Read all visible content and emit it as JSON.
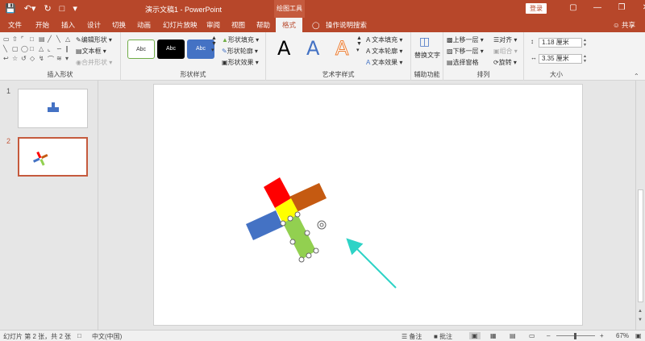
{
  "titlebar": {
    "doc_title": "演示文稿1  -  PowerPoint",
    "context_title": "绘图工具",
    "login": "登录"
  },
  "tabs": {
    "file": "文件",
    "home": "开始",
    "insert": "插入",
    "design": "设计",
    "transitions": "切换",
    "animations": "动画",
    "slideshow": "幻灯片放映",
    "review": "审阅",
    "view": "视图",
    "help": "帮助",
    "format": "格式",
    "tellme": "操作说明搜索",
    "share": "共享"
  },
  "ribbon": {
    "insert_shapes": {
      "label": "插入形状",
      "edit_shape": "编辑形状",
      "textbox": "文本框",
      "merge_shapes": "合并形状"
    },
    "shape_styles": {
      "label": "形状样式",
      "swatch_text": "Abc",
      "fill": "形状填充",
      "outline": "形状轮廓",
      "effects": "形状效果"
    },
    "wordart": {
      "label": "艺术字样式",
      "letter": "A",
      "text_fill": "文本填充",
      "text_outline": "文本轮廓",
      "text_effects": "文本效果"
    },
    "accessibility": {
      "label": "辅助功能",
      "alt_text": "替换文字"
    },
    "arrange": {
      "label": "排列",
      "bring_forward": "上移一层",
      "send_backward": "下移一层",
      "selection_pane": "选择窗格",
      "align": "对齐",
      "group": "组合",
      "rotate": "旋转"
    },
    "size": {
      "label": "大小",
      "height": "1.18 厘米",
      "width": "3.35 厘米"
    }
  },
  "thumbnails": {
    "slide1_num": "1",
    "slide2_num": "2"
  },
  "statusbar": {
    "slide_info": "幻灯片 第 2 张，共 2 张",
    "language": "中文(中国)",
    "notes": "备注",
    "comments": "批注",
    "zoom": "67%"
  },
  "colors": {
    "accent": "#b7472a",
    "red_blade": "#ff0000",
    "orange_blade": "#c55a11",
    "blue_blade": "#4472c4",
    "green_blade": "#92d050",
    "yellow_center": "#ffff00",
    "arrow": "#2ed3c6"
  }
}
